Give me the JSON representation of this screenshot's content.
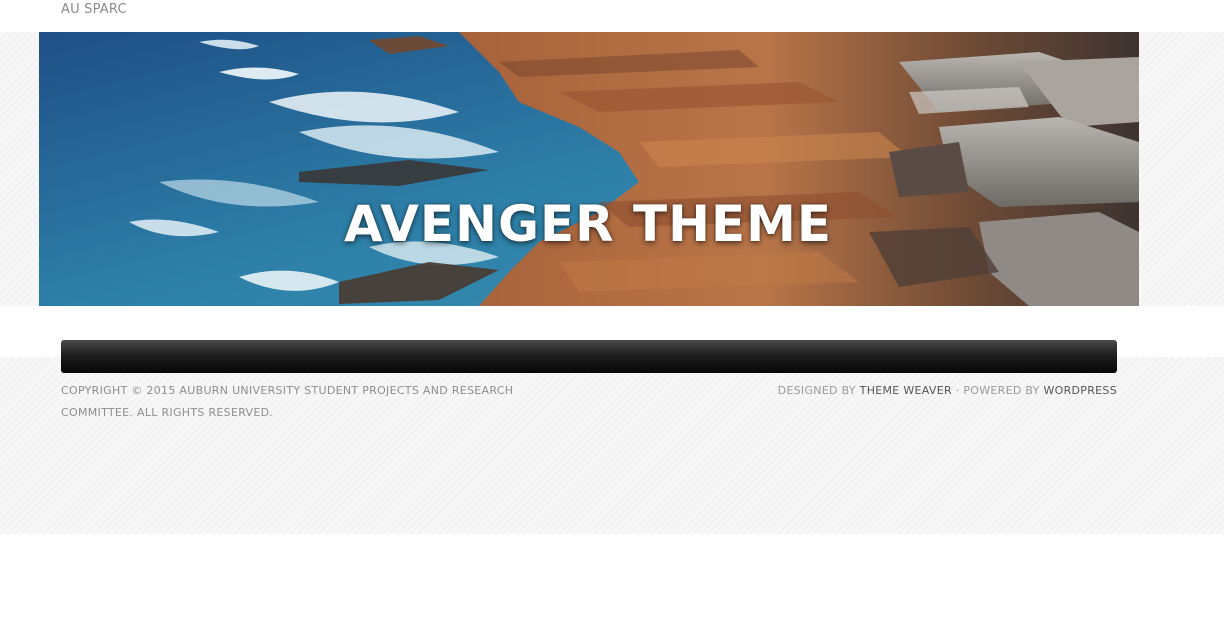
{
  "site": {
    "title": "AU SPARC"
  },
  "header": {
    "image_text": "AVENGER THEME"
  },
  "footer": {
    "copyright": "COPYRIGHT © 2015 AUBURN UNIVERSITY STUDENT PROJECTS AND RESEARCH COMMITTEE. ALL RIGHTS RESERVED.",
    "designed_by_prefix": "DESIGNED BY",
    "designer_link": "THEME WEAVER",
    "separator": "·",
    "powered_by_prefix": "POWERED BY",
    "platform_link": "WORDPRESS"
  }
}
